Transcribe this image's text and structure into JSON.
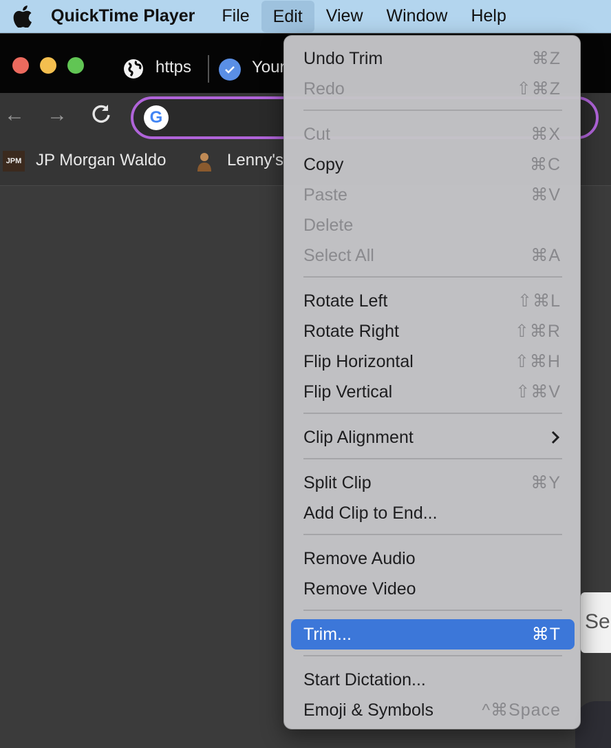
{
  "menubar": {
    "app_name": "QuickTime Player",
    "items": [
      "File",
      "Edit",
      "View",
      "Window",
      "Help"
    ],
    "active": "Edit"
  },
  "browser": {
    "tabs": [
      {
        "label": "https"
      },
      {
        "label": "Your"
      }
    ],
    "bookmarks": [
      {
        "icon": "JPM",
        "label": "JP Morgan Waldo"
      },
      {
        "label": "Lenny's"
      }
    ],
    "search_chip": "Sea"
  },
  "edit_menu": {
    "items": [
      {
        "label": "Undo Trim",
        "shortcut": "⌘Z",
        "enabled": true
      },
      {
        "label": "Redo",
        "shortcut": "⇧⌘Z",
        "enabled": false
      },
      {
        "label": "Cut",
        "shortcut": "⌘X",
        "enabled": false
      },
      {
        "label": "Copy",
        "shortcut": "⌘C",
        "enabled": true
      },
      {
        "label": "Paste",
        "shortcut": "⌘V",
        "enabled": false
      },
      {
        "label": "Delete",
        "shortcut": "",
        "enabled": false
      },
      {
        "label": "Select All",
        "shortcut": "⌘A",
        "enabled": false
      },
      {
        "label": "Rotate Left",
        "shortcut": "⇧⌘L",
        "enabled": true
      },
      {
        "label": "Rotate Right",
        "shortcut": "⇧⌘R",
        "enabled": true
      },
      {
        "label": "Flip Horizontal",
        "shortcut": "⇧⌘H",
        "enabled": true
      },
      {
        "label": "Flip Vertical",
        "shortcut": "⇧⌘V",
        "enabled": true
      },
      {
        "label": "Clip Alignment",
        "shortcut": "",
        "enabled": true,
        "submenu": true
      },
      {
        "label": "Split Clip",
        "shortcut": "⌘Y",
        "enabled": true
      },
      {
        "label": "Add Clip to End...",
        "shortcut": "",
        "enabled": true
      },
      {
        "label": "Remove Audio",
        "shortcut": "",
        "enabled": true
      },
      {
        "label": "Remove Video",
        "shortcut": "",
        "enabled": true
      },
      {
        "label": "Trim...",
        "shortcut": "⌘T",
        "enabled": true,
        "highlighted": true
      },
      {
        "label": "Start Dictation...",
        "shortcut": "",
        "enabled": true
      },
      {
        "label": "Emoji & Symbols",
        "shortcut": "^⌘Space",
        "enabled": true
      }
    ]
  },
  "colors": {
    "menubar_bg": "#b3d5ee",
    "highlight": "#3c77d9",
    "omnibox_border": "#b064d9"
  }
}
